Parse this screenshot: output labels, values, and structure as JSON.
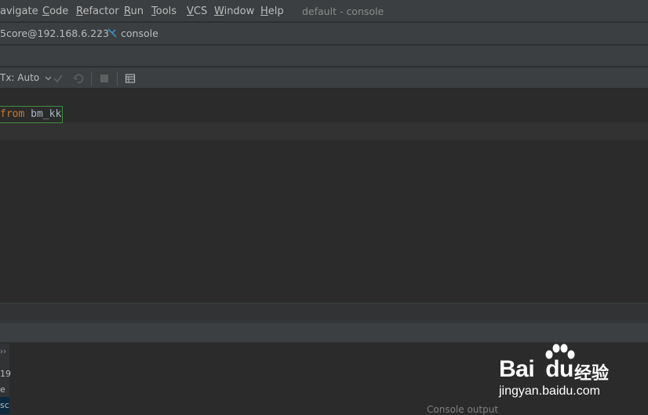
{
  "menu": {
    "items": [
      "avigate",
      "Code",
      "Refactor",
      "Run",
      "Tools",
      "VCS",
      "Window",
      "Help"
    ],
    "window_title": "default - console"
  },
  "breadcrumb": {
    "datasource": "5core@192.168.6.223",
    "console": "console"
  },
  "toolbar": {
    "tx_label": "Tx: Auto"
  },
  "editor": {
    "keyword": "from",
    "identifier": "bm_kk"
  },
  "bottom_panel": {
    "side_labels": [
      "19",
      "e",
      "sc"
    ],
    "console_output_label": "Console output"
  },
  "watermark": {
    "brand": "Bai",
    "brand2": "du",
    "cn": "经验",
    "url": "jingyan.baidu.com"
  },
  "colors": {
    "keyword": "#cc7832",
    "identifier": "#a9b7c6",
    "editor_bg": "#2b2b2b",
    "chrome_bg": "#3c3f41",
    "highlight_border": "#3f8f3f"
  }
}
